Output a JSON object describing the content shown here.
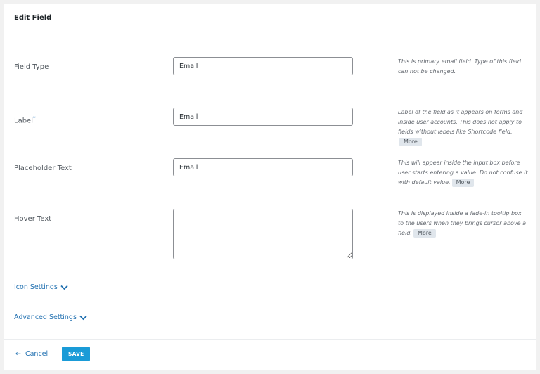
{
  "header": {
    "title": "Edit Field"
  },
  "fields": {
    "field_type": {
      "label": "Field Type",
      "value": "Email",
      "help": "This is primary email field. Type of this field can not be changed."
    },
    "label": {
      "label": "Label",
      "required_mark": "*",
      "value": "Email",
      "help": "Label of the field as it appears on forms and inside user accounts. This does not apply to fields without labels like Shortcode field.",
      "more": "More"
    },
    "placeholder": {
      "label": "Placeholder Text",
      "value": "Email",
      "help": "This will appear inside the input box before user starts entering a value. Do not confuse it with default value.",
      "more": "More"
    },
    "hover": {
      "label": "Hover Text",
      "value": "",
      "help": "This is displayed inside a fade-in tooltip box to the users when they brings cursor above a field.",
      "more": "More"
    }
  },
  "sections": {
    "icon_settings": "Icon Settings",
    "advanced_settings": "Advanced Settings"
  },
  "footer": {
    "cancel_arrow": "←",
    "cancel_label": "Cancel",
    "save_label": "SAVE"
  },
  "colors": {
    "accent": "#2271b1",
    "save_button": "#1a9bd7"
  }
}
